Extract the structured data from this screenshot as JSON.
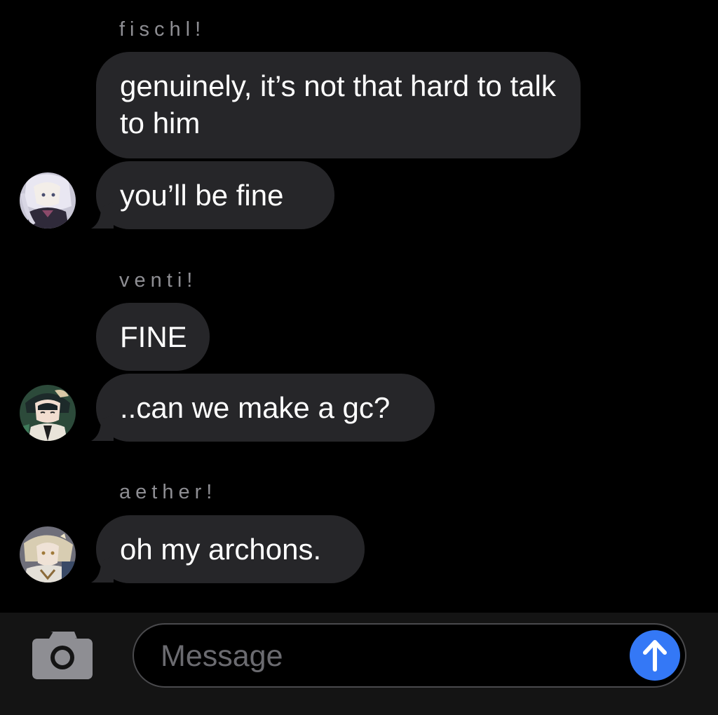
{
  "colors": {
    "background": "#000000",
    "bubble": "#262629",
    "sender_label": "#8e8e93",
    "composer_bar": "#141414",
    "send_button": "#3478f6"
  },
  "messages": [
    {
      "sender": "fischl!",
      "bubbles": [
        "genuinely, it’s not that hard to talk to him",
        "you’ll be fine"
      ],
      "avatar": "fischl-avatar"
    },
    {
      "sender": "venti!",
      "bubbles": [
        "FINE",
        "..can we make a gc?"
      ],
      "avatar": "venti-avatar"
    },
    {
      "sender": "aether!",
      "bubbles": [
        "oh my archons."
      ],
      "avatar": "aether-avatar"
    }
  ],
  "composer": {
    "placeholder": "Message",
    "camera_icon": "camera-icon",
    "send_icon": "arrow-up-icon"
  }
}
